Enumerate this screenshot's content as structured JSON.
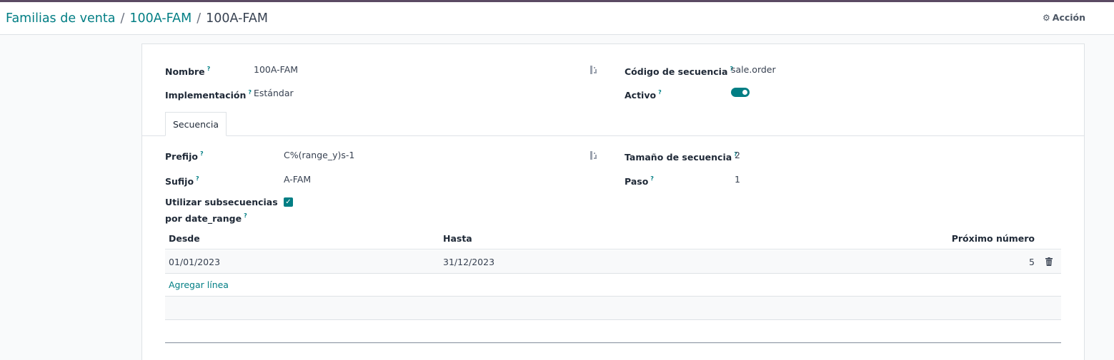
{
  "breadcrumb": {
    "parent": "Familias de venta",
    "middle": "100A-FAM",
    "current": "100A-FAM",
    "separator": "/"
  },
  "action": {
    "label": "Acción",
    "icon": "gear-icon"
  },
  "form": {
    "nombre_label": "Nombre",
    "nombre_value": "100A-FAM",
    "implementacion_label": "Implementación",
    "implementacion_value": "Estándar",
    "codigo_label": "Código de secuencia",
    "codigo_value": "sale.order",
    "activo_label": "Activo",
    "activo_value": true,
    "help_mark": "?"
  },
  "tabs": [
    {
      "label": "Secuencia",
      "active": true
    }
  ],
  "sequence": {
    "prefijo_label": "Prefijo",
    "prefijo_value": "C%(range_y)s-1",
    "sufijo_label": "Sufijo",
    "sufijo_value": "A-FAM",
    "subsec_label_line1": "Utilizar subsecuencias",
    "subsec_label_line2": "por date_range",
    "subsec_checked": true,
    "tamano_label": "Tamaño de secuencia",
    "tamano_value": "2",
    "paso_label": "Paso",
    "paso_value": "1"
  },
  "table": {
    "columns": [
      "Desde",
      "Hasta",
      "Próximo número"
    ],
    "rows": [
      {
        "desde": "01/01/2023",
        "hasta": "31/12/2023",
        "proximo": "5"
      }
    ],
    "add_line_label": "Agregar línea"
  },
  "colors": {
    "accent": "#017e84",
    "topbar": "#5b4a63"
  }
}
